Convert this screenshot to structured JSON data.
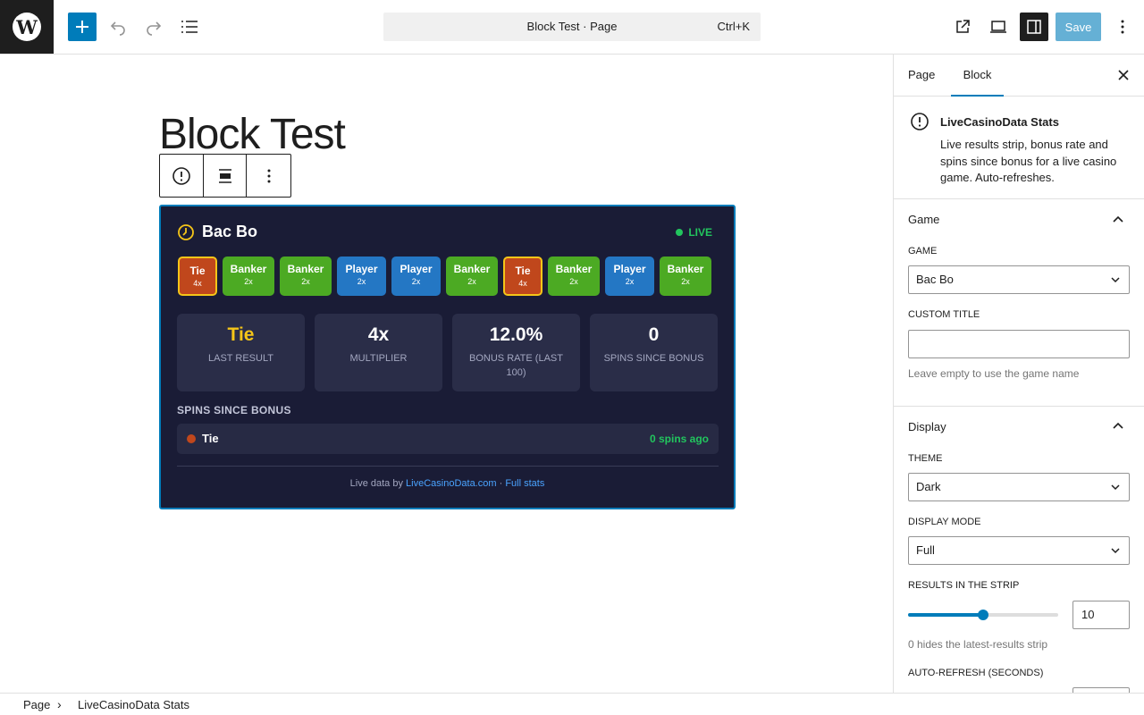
{
  "topbar": {
    "cmd_title": "Block Test · Page",
    "shortcut": "Ctrl+K",
    "save_label": "Save",
    "icons": [
      "wordpress-logo",
      "plus-icon",
      "undo-icon",
      "redo-icon",
      "list-view-icon",
      "external-link-icon",
      "desktop-preview-icon",
      "sidebar-toggle-icon",
      "more-vertical-icon"
    ]
  },
  "post": {
    "title": "Block Test"
  },
  "widget": {
    "game_name": "Bac Bo",
    "live_label": "LIVE",
    "results": [
      {
        "label": "Tie",
        "mult": "4x",
        "type": "tie"
      },
      {
        "label": "Banker",
        "mult": "2x",
        "type": "banker"
      },
      {
        "label": "Banker",
        "mult": "2x",
        "type": "banker"
      },
      {
        "label": "Player",
        "mult": "2x",
        "type": "player"
      },
      {
        "label": "Player",
        "mult": "2x",
        "type": "player"
      },
      {
        "label": "Banker",
        "mult": "2x",
        "type": "banker"
      },
      {
        "label": "Tie",
        "mult": "4x",
        "type": "tie"
      },
      {
        "label": "Banker",
        "mult": "2x",
        "type": "banker"
      },
      {
        "label": "Player",
        "mult": "2x",
        "type": "player"
      },
      {
        "label": "Banker",
        "mult": "2x",
        "type": "banker"
      }
    ],
    "stats": [
      {
        "value": "Tie",
        "label": "LAST RESULT",
        "highlight": true
      },
      {
        "value": "4x",
        "label": "MULTIPLIER",
        "highlight": false
      },
      {
        "value": "12.0%",
        "label": "BONUS RATE (LAST 100)",
        "highlight": false
      },
      {
        "value": "0",
        "label": "SPINS SINCE BONUS",
        "highlight": false
      }
    ],
    "section_title": "SPINS SINCE BONUS",
    "bonus_row": {
      "name": "Tie",
      "ago": "0 spins ago"
    },
    "footer_prefix": "Live data by",
    "footer_link": "LiveCasinoData.com",
    "footer_sep": "·",
    "footer_stats_link": "Full stats",
    "colors": {
      "tie": "#c0471c",
      "banker": "#4caa23",
      "player": "#2477c4",
      "live": "#22c55e",
      "accent": "#f5c518",
      "bg": "#1a1c36"
    }
  },
  "sidebar": {
    "tab_page": "Page",
    "tab_block": "Block",
    "block_name": "LiveCasinoData Stats",
    "block_desc": "Live results strip, bonus rate and spins since bonus for a live casino game. Auto-refreshes.",
    "game_panel": {
      "title": "Game",
      "game_label": "GAME",
      "game_value": "Bac Bo",
      "custom_title_label": "CUSTOM TITLE",
      "custom_title_value": "",
      "custom_title_help": "Leave empty to use the game name"
    },
    "display_panel": {
      "title": "Display",
      "theme_label": "THEME",
      "theme_value": "Dark",
      "mode_label": "DISPLAY MODE",
      "mode_value": "Full",
      "strip_label": "RESULTS IN THE STRIP",
      "strip_value": "10",
      "strip_fraction": 0.5,
      "strip_help": "0 hides the latest-results strip",
      "refresh_label": "AUTO-REFRESH (SECONDS)"
    }
  },
  "breadcrumb": {
    "page": "Page",
    "block": "LiveCasinoData Stats"
  }
}
